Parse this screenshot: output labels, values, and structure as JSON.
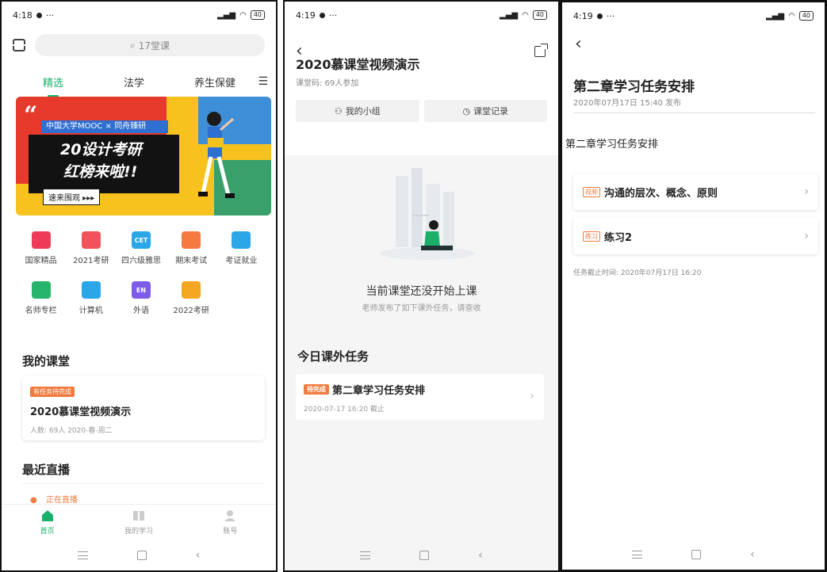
{
  "status_bar": {
    "p1_time": "4:18",
    "p2_time": "4:19",
    "p3_time": "4:19",
    "more": "···",
    "battery": "40"
  },
  "home": {
    "search_placeholder": "17堂课",
    "tabs": [
      "精选",
      "法学",
      "养生保健"
    ],
    "banner": {
      "top_line": "中国大学MOOC × 同舟臻研",
      "line1": "20设计考研",
      "line2": "红榜来啦!!",
      "cta": "速来围观 ▸▸▸"
    },
    "categories": [
      {
        "label": "国家精品",
        "icon": "crown-icon",
        "color": "#ee3b59"
      },
      {
        "label": "2021考研",
        "icon": "graduation-cap-icon",
        "color": "#f0535a"
      },
      {
        "label": "四六级雅思",
        "icon": "cet-icon",
        "color": "#2ba6e6",
        "text": "CET"
      },
      {
        "label": "期末考试",
        "icon": "exam-icon",
        "color": "#f57a42"
      },
      {
        "label": "考证就业",
        "icon": "briefcase-icon",
        "color": "#2ba6e6"
      },
      {
        "label": "名师专栏",
        "icon": "teacher-icon",
        "color": "#26b56b"
      },
      {
        "label": "计算机",
        "icon": "computer-icon",
        "color": "#2ba6e6"
      },
      {
        "label": "外语",
        "icon": "language-icon",
        "color": "#7d5ce6",
        "text": "EN"
      },
      {
        "label": "2022考研",
        "icon": "graduation-cap-icon",
        "color": "#f5a623"
      }
    ],
    "my_class_title": "我的课堂",
    "class_card": {
      "badge": "有任务待完成",
      "title": "2020慕课堂视频演示",
      "meta": "人数: 69人   2020-春-周二"
    },
    "live_title": "最近直播",
    "live_status": "正在直播",
    "bottom_nav": [
      "首页",
      "我的学习",
      "账号"
    ]
  },
  "classroom": {
    "title": "2020慕课堂视频演示",
    "subtitle": "课堂码:   69人参加",
    "btn_group": "我的小组",
    "btn_record": "课堂记录",
    "empty_title": "当前课堂还没开始上课",
    "empty_sub": "老师发布了如下课外任务，请查收",
    "section": "今日课外任务",
    "task_badge": "待完成",
    "task_title": "第二章学习任务安排",
    "task_date": "2020-07-17 16:20 截止"
  },
  "task_detail": {
    "title": "第二章学习任务安排",
    "published": "2020年07月17日 15:40 发布",
    "label": "第二章学习任务安排",
    "items": [
      {
        "tag": "视频",
        "title": "沟通的层次、概念、原则"
      },
      {
        "tag": "练习",
        "title": "练习2"
      }
    ],
    "deadline": "任务截止时间: 2020年07月17日 16:20"
  }
}
